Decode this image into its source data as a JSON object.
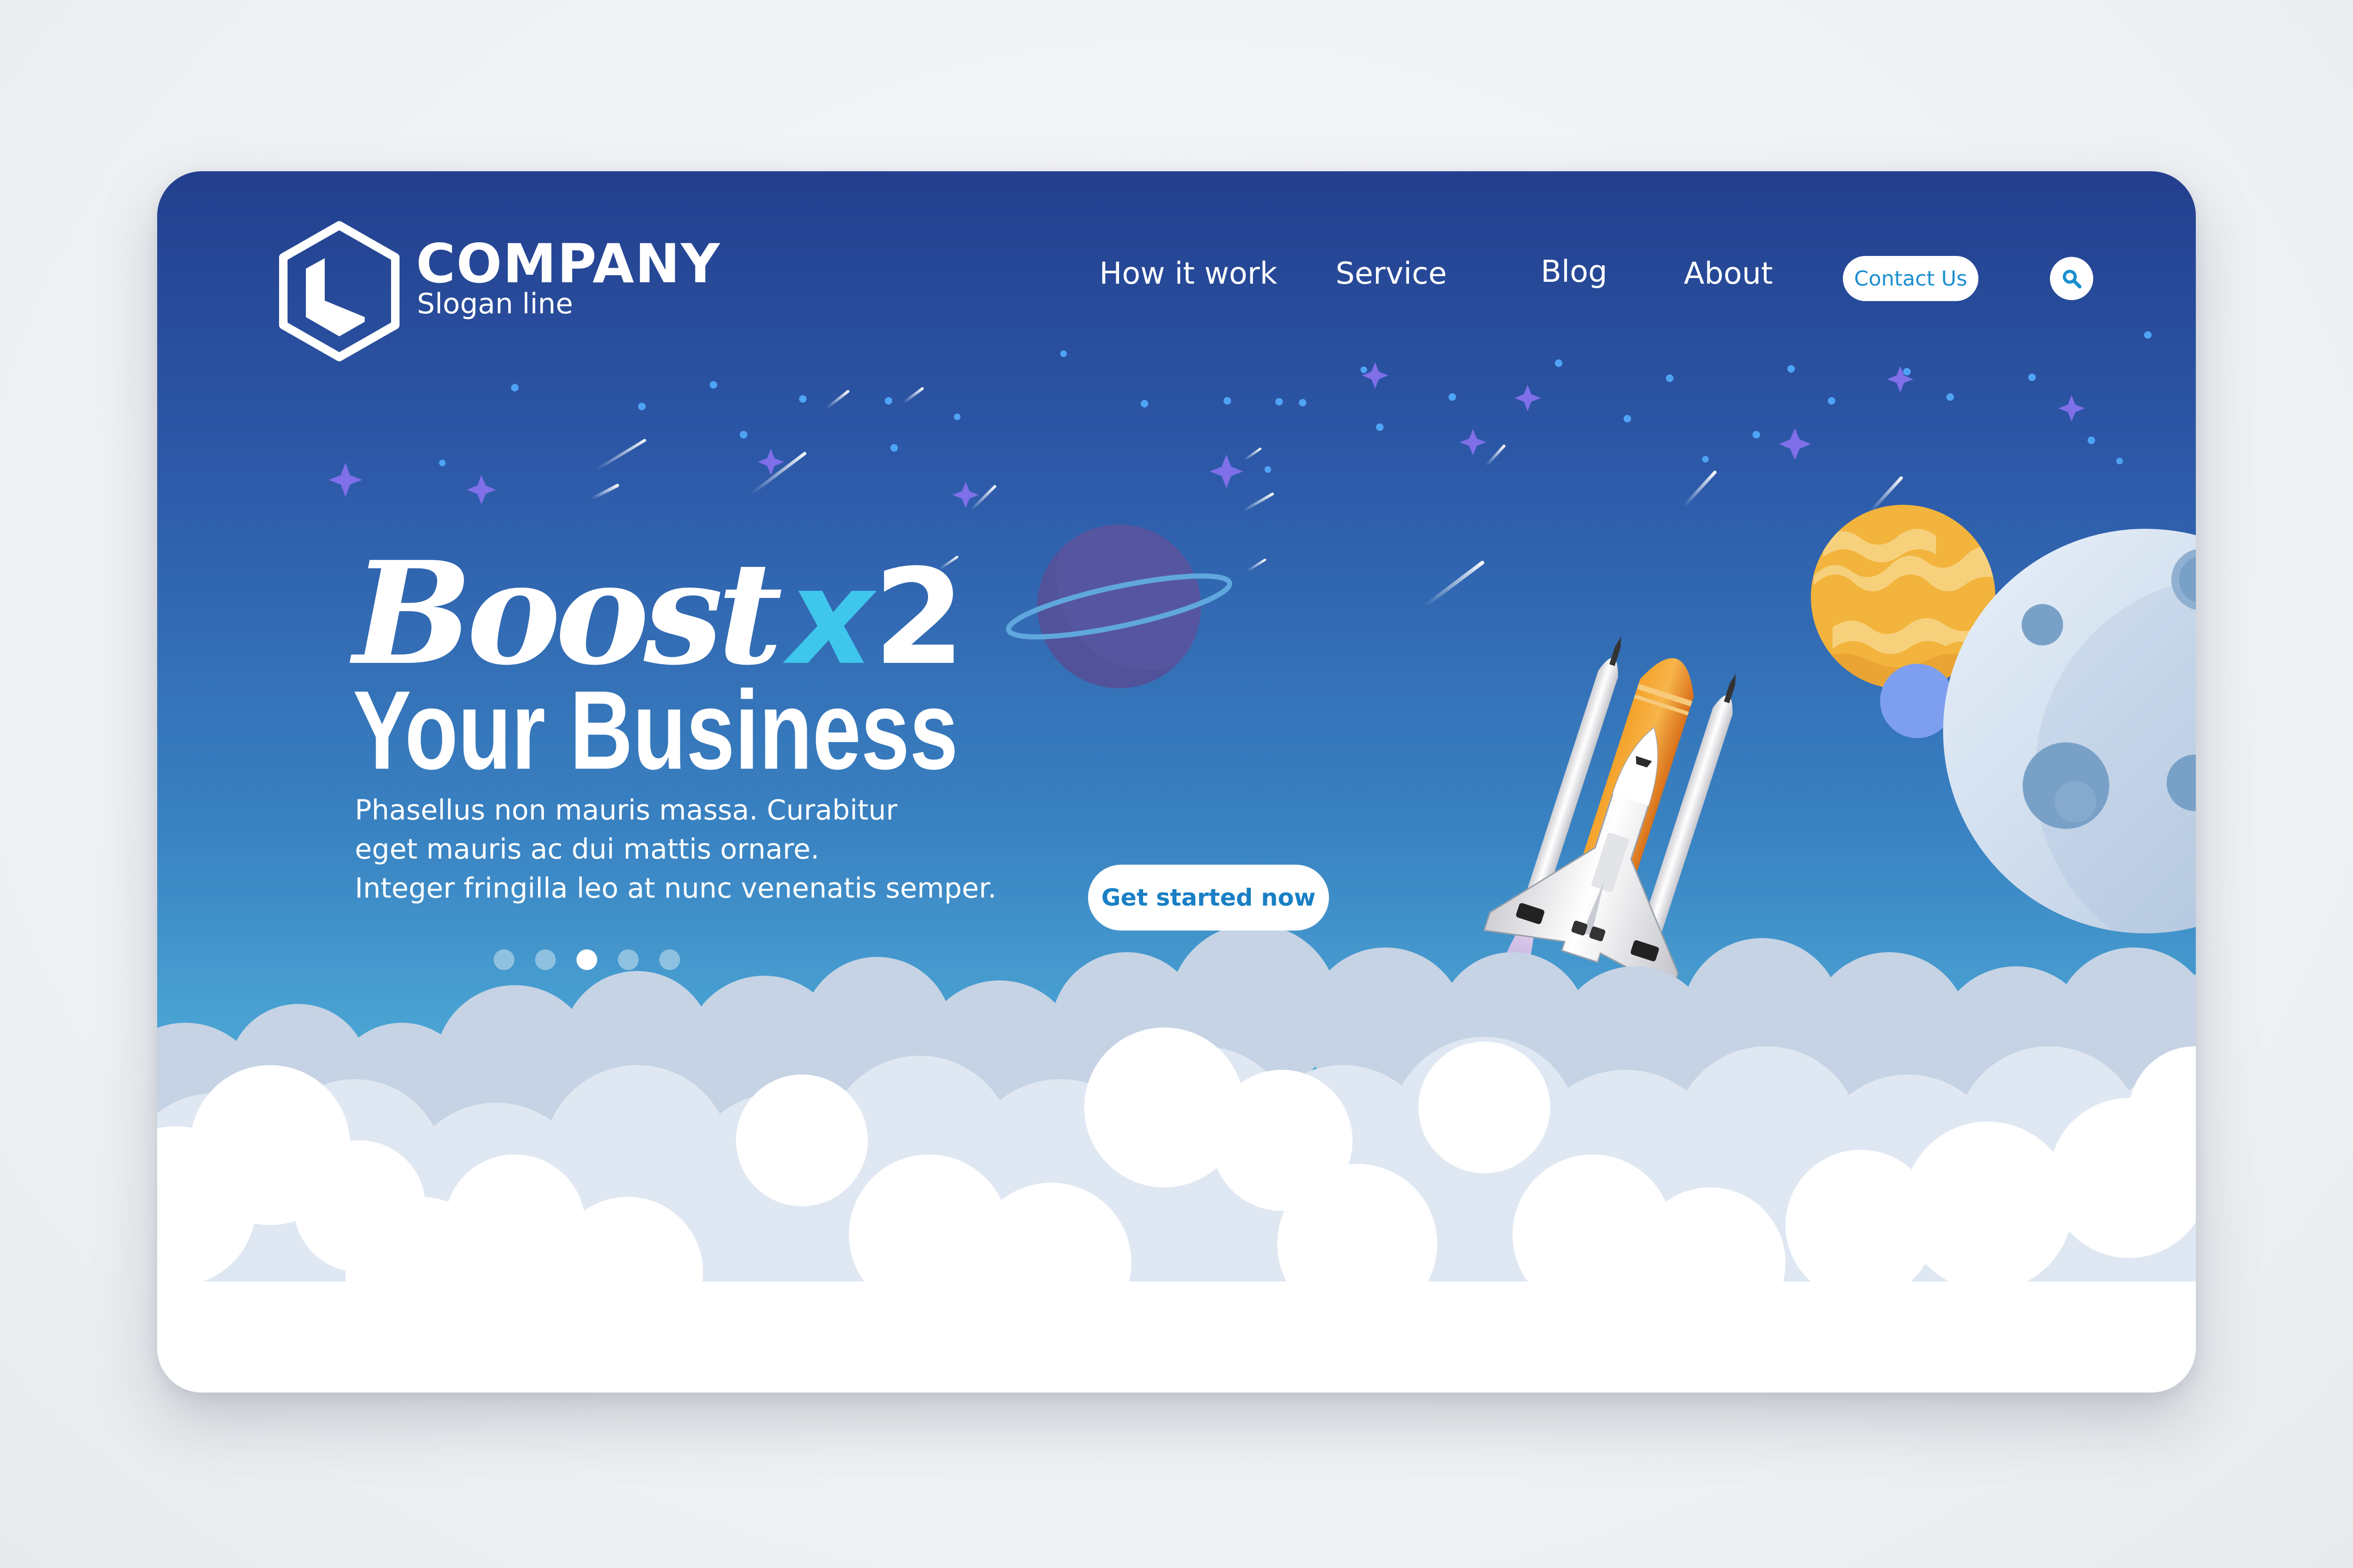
{
  "brand": {
    "name": "COMPANY",
    "slogan": "Slogan line"
  },
  "nav": {
    "items": [
      {
        "label": "How it work"
      },
      {
        "label": "Service"
      },
      {
        "label": "Blog"
      },
      {
        "label": "About"
      }
    ],
    "contact_label": "Contact Us",
    "search_icon": "search-icon"
  },
  "hero": {
    "headline_word": "Boost",
    "headline_x": "x",
    "headline_number": "2",
    "subheadline": "Your Business",
    "body_lines": [
      "Phasellus non mauris massa.  Curabitur",
      "eget mauris ac dui mattis ornare.",
      "Integer fringilla leo at nunc venenatis semper."
    ],
    "cta_label": "Get started now"
  },
  "carousel": {
    "count": 5,
    "active_index": 2
  },
  "colors": {
    "sky_top": "#233f8e",
    "sky_bottom": "#6cc6e6",
    "accent_cyan": "#3fc6ec",
    "button_text": "#1a8fd0",
    "planet_purple": "#52529a",
    "planet_orange": "#f2b43c",
    "planet_blue": "#7e9ef0",
    "moon": "#c6d6ea",
    "rocket_tank": "#f08a1e"
  }
}
